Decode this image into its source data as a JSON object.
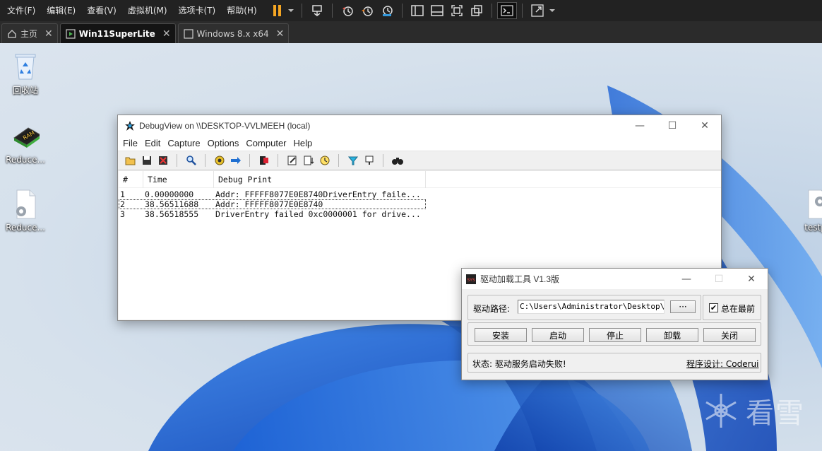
{
  "vmware": {
    "menu": [
      "文件(F)",
      "编辑(E)",
      "查看(V)",
      "虚拟机(M)",
      "选项卡(T)",
      "帮助(H)"
    ],
    "tabs": [
      {
        "label": "主页",
        "icon": "home-icon"
      },
      {
        "label": "Win11SuperLite",
        "icon": "vm-running-icon",
        "active": true
      },
      {
        "label": "Windows 8.x x64",
        "icon": "vm-icon"
      }
    ],
    "accent": "#f5a623"
  },
  "desktop": {
    "icons": [
      {
        "label": "回收站",
        "icon": "recycle-bin-icon"
      },
      {
        "label": "Reduce...",
        "icon": "ram-chip-icon"
      },
      {
        "label": "Reduce...",
        "icon": "settings-file-icon"
      },
      {
        "label": "testpr",
        "icon": "settings-file-icon"
      }
    ]
  },
  "debugview": {
    "title": "DebugView on \\\\DESKTOP-VVLMEEH (local)",
    "menu": [
      "File",
      "Edit",
      "Capture",
      "Options",
      "Computer",
      "Help"
    ],
    "columns": [
      "#",
      "Time",
      "Debug Print"
    ],
    "rows": [
      {
        "num": "1",
        "time": "0.00000000",
        "text": "Addr: FFFFF8077E0E8740DriverEntry faile..."
      },
      {
        "num": "2",
        "time": "38.56511688",
        "text": "Addr: FFFFF8077E0E8740",
        "selected": true
      },
      {
        "num": "3",
        "time": "38.56518555",
        "text": "DriverEntry failed 0xc0000001 for drive..."
      }
    ]
  },
  "driver_tool": {
    "title": "驱动加载工具 V1.3版",
    "path_label": "驱动路径:",
    "path_value": "C:\\Users\\Administrator\\Desktop\\tes",
    "browse_label": "···",
    "always_on_top_label": "总在最前",
    "always_on_top_checked": true,
    "buttons": [
      "安装",
      "启动",
      "停止",
      "卸载",
      "关闭"
    ],
    "status": "状态: 驱动服务启动失败!",
    "credit": "程序设计: Coderui"
  },
  "watermark": {
    "text": "看雪"
  }
}
